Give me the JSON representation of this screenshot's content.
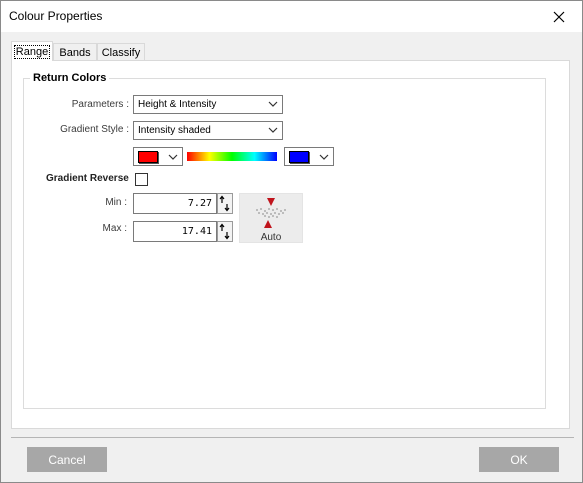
{
  "window": {
    "title": "Colour Properties"
  },
  "tabs": [
    {
      "label": "Range",
      "active": true
    },
    {
      "label": "Bands",
      "active": false
    },
    {
      "label": "Classify",
      "active": false
    }
  ],
  "return_colors": {
    "legend": "Return Colors",
    "parameters_label": "Parameters :",
    "parameters_value": "Height & Intensity",
    "gradient_style_label": "Gradient Style :",
    "gradient_style_value": "Intensity shaded",
    "start_color": "#ff0000",
    "end_color": "#0000ff",
    "gradient_stops": [
      "#ff0000",
      "#ffff00",
      "#00ff00",
      "#00ffff",
      "#0000ff"
    ],
    "gradient_reverse_label": "Gradient Reverse",
    "gradient_reverse_checked": false,
    "min_label": "Min :",
    "min_value": "7.27",
    "max_label": "Max :",
    "max_value": "17.41",
    "auto_label": "Auto"
  },
  "buttons": {
    "cancel": "Cancel",
    "ok": "OK"
  },
  "colors": {
    "button_bg": "#a7a7a7",
    "auto_arrow": "#c0141c"
  }
}
